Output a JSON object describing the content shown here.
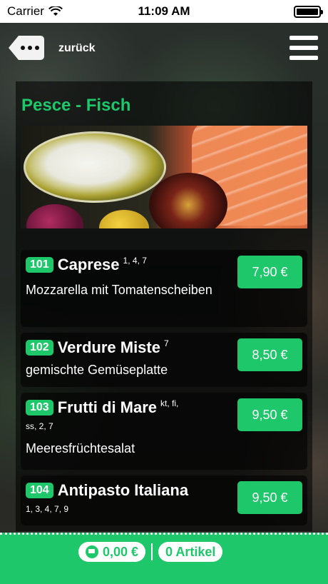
{
  "status": {
    "carrier": "Carrier",
    "time": "11:09 AM"
  },
  "nav": {
    "back_label": "zurück"
  },
  "category": {
    "title": "Pesce - Fisch"
  },
  "items": [
    {
      "num": "101",
      "name": "Caprese",
      "allergens": "1, 4, 7",
      "description": "Mozzarella mit Tomatenscheiben",
      "price": "7,90 €"
    },
    {
      "num": "102",
      "name": "Verdure Miste",
      "allergens": "7",
      "description": "gemischte Gemüseplatte",
      "price": "8,50 €"
    },
    {
      "num": "103",
      "name": "Frutti di Mare",
      "allergens": "kt, fi,",
      "allergens_line2": "ss, 2, 7",
      "description": "Meeresfrüchtesalat",
      "price": "9,50 €"
    },
    {
      "num": "104",
      "name": "Antipasto Italiana",
      "allergens": "1, 3, 4, 7, 9",
      "description": "",
      "price": "9,50 €"
    }
  ],
  "cart": {
    "total": "0,00 €",
    "count_label": "0 Artikel"
  },
  "colors": {
    "accent": "#1ec86a"
  }
}
